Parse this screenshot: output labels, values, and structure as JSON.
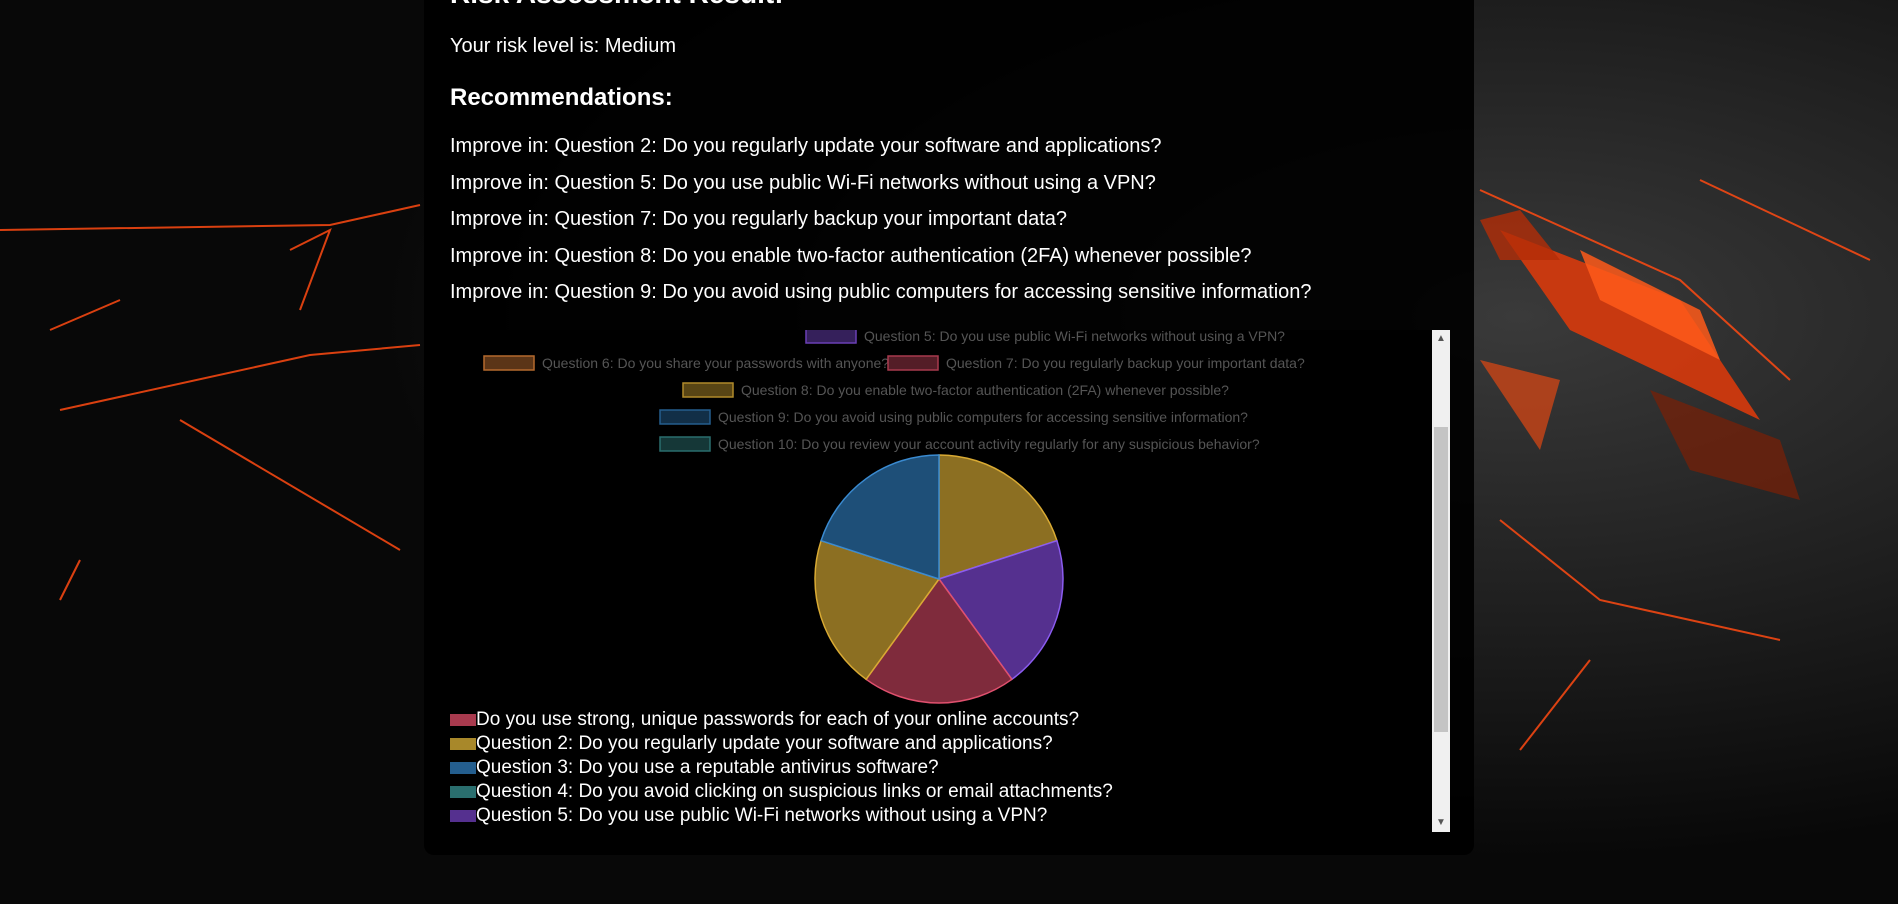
{
  "page": {
    "title": "Risk Assessment Result:",
    "risk_line": "Your risk level is: Medium",
    "recommendations_heading": "Recommendations:",
    "recommendations": [
      "Improve in: Question 2: Do you regularly update your software and applications?",
      "Improve in: Question 5: Do you use public Wi-Fi networks without using a VPN?",
      "Improve in: Question 7: Do you regularly backup your important data?",
      "Improve in: Question 8: Do you enable two-factor authentication (2FA) whenever possible?",
      "Improve in: Question 9: Do you avoid using public computers for accessing sensitive information?"
    ]
  },
  "colors": {
    "panel_bg": "#000000",
    "text": "#ffffff",
    "accent_orange": "#ff4a12"
  },
  "chart_data": {
    "type": "pie",
    "chart_legend": [
      {
        "label": "Question 5: Do you use public Wi-Fi networks without using a VPN?",
        "color": "#6a3fb5"
      },
      {
        "label": "Question 6: Do you share your passwords with anyone?",
        "color": "#b56a2e"
      },
      {
        "label": "Question 7: Do you regularly backup your important data?",
        "color": "#a83a4e"
      },
      {
        "label": "Question 8: Do you enable two-factor authentication (2FA) whenever possible?",
        "color": "#b08a2a"
      },
      {
        "label": "Question 9: Do you avoid using public computers for accessing sensitive information?",
        "color": "#245e8e"
      },
      {
        "label": "Question 10: Do you review your account activity regularly for any suspicious behavior?",
        "color": "#2a6e6e"
      }
    ],
    "slices": [
      {
        "value": 1,
        "color": "#8c6f22",
        "stroke": "#d9aa33"
      },
      {
        "value": 1,
        "color": "#55308f",
        "stroke": "#8b5cf0"
      },
      {
        "value": 1,
        "color": "#7f2b3c",
        "stroke": "#e0506e"
      },
      {
        "value": 1,
        "color": "#8c6f22",
        "stroke": "#d9aa33"
      },
      {
        "value": 1,
        "color": "#1e4f78",
        "stroke": "#3a8ad0"
      }
    ],
    "legend_below": [
      {
        "label": "Do you use strong, unique passwords for each of your online accounts?",
        "color": "#a83a4e"
      },
      {
        "label": "Question 2: Do you regularly update your software and applications?",
        "color": "#a8882a"
      },
      {
        "label": "Question 3: Do you use a reputable antivirus software?",
        "color": "#245e8e"
      },
      {
        "label": "Question 4: Do you avoid clicking on suspicious links or email attachments?",
        "color": "#2a6e6e"
      },
      {
        "label": "Question 5: Do you use public Wi-Fi networks without using a VPN?",
        "color": "#55308f"
      }
    ]
  }
}
